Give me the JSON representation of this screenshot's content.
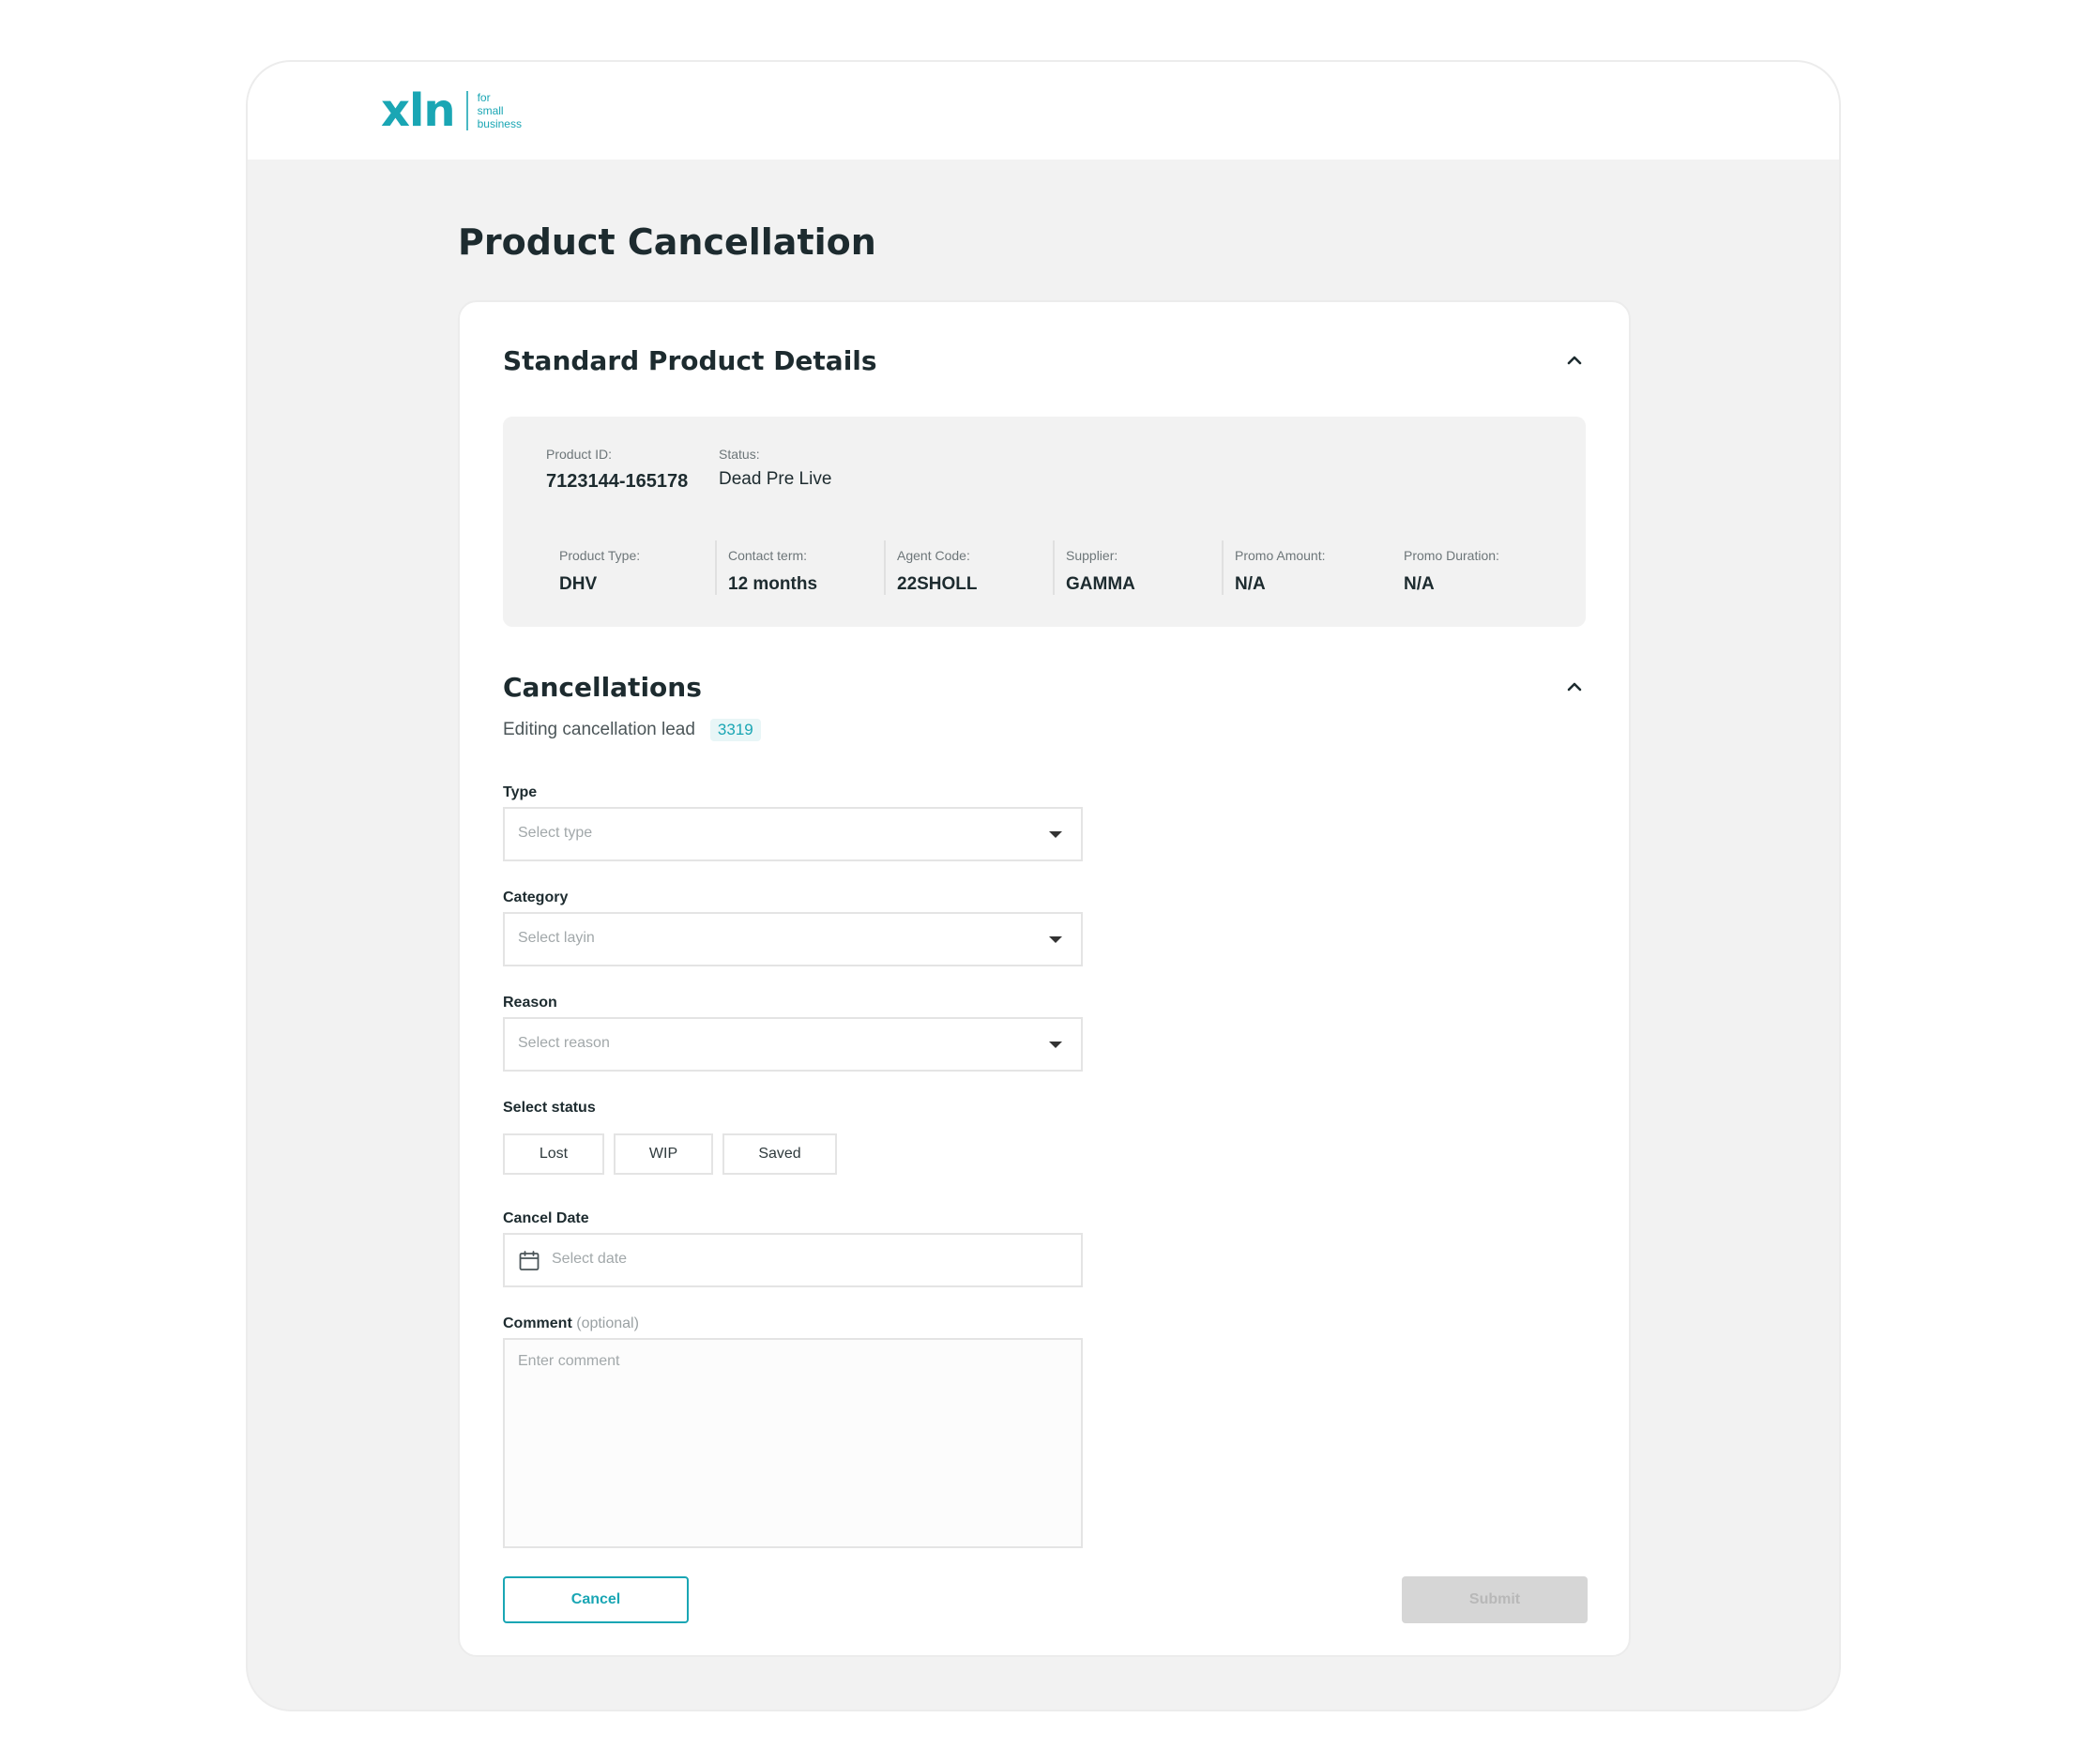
{
  "brand": {
    "logo_text": "xln",
    "tagline": [
      "for",
      "small",
      "business"
    ],
    "accent_color": "#1aa6b4"
  },
  "page": {
    "title": "Product Cancellation"
  },
  "standard_details": {
    "title": "Standard Product Details",
    "collapse_icon": "chevron-up-icon",
    "product_id_label": "Product ID:",
    "product_id": "7123144-165178",
    "status_label": "Status:",
    "status": "Dead Pre Live",
    "fields": [
      {
        "label": "Product Type:",
        "value": "DHV"
      },
      {
        "label": "Contact term:",
        "value": "12 months"
      },
      {
        "label": "Agent Code:",
        "value": "22SHOLL"
      },
      {
        "label": "Supplier:",
        "value": "GAMMA"
      },
      {
        "label": "Promo Amount:",
        "value": "N/A"
      },
      {
        "label": "Promo Duration:",
        "value": "N/A"
      }
    ]
  },
  "cancellations": {
    "title": "Cancellations",
    "collapse_icon": "chevron-up-icon",
    "subtitle": "Editing cancellation lead",
    "lead_id": "3319",
    "type": {
      "label": "Type",
      "placeholder": "Select type"
    },
    "category": {
      "label": "Category",
      "placeholder": "Select layin"
    },
    "reason": {
      "label": "Reason",
      "placeholder": "Select reason"
    },
    "status": {
      "label": "Select status",
      "options": [
        "Lost",
        "WIP",
        "Saved"
      ]
    },
    "cancel_date": {
      "label": "Cancel Date",
      "placeholder": "Select date",
      "icon": "calendar-icon"
    },
    "comment": {
      "label": "Comment",
      "optional": "(optional)",
      "placeholder": "Enter comment"
    },
    "cancel_button": "Cancel",
    "submit_button": "Submit"
  }
}
